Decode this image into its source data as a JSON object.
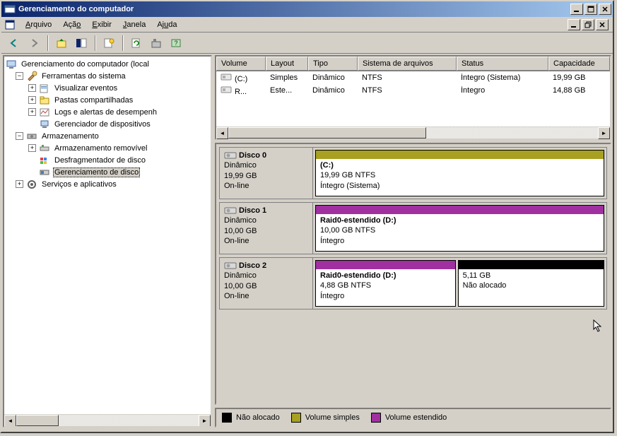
{
  "window": {
    "title": "Gerenciamento do computador"
  },
  "menu": {
    "arquivo": "Arquivo",
    "acao": "Ação",
    "exibir": "Exibir",
    "janela": "Janela",
    "ajuda": "Ajuda"
  },
  "tree": {
    "root": "Gerenciamento do computador (local",
    "ferramentas": "Ferramentas do sistema",
    "visualizar_eventos": "Visualizar eventos",
    "pastas_compartilhadas": "Pastas compartilhadas",
    "logs_alertas": "Logs e alertas de desempenh",
    "gerenciador_disp": "Gerenciador de dispositivos",
    "armazenamento": "Armazenamento",
    "armaz_removivel": "Armazenamento removível",
    "desfragmentador": "Desfragmentador de disco",
    "gerenciamento_disco": "Gerenciamento de disco",
    "servicos": "Serviços e aplicativos"
  },
  "volumes": {
    "headers": {
      "volume": "Volume",
      "layout": "Layout",
      "tipo": "Tipo",
      "sistema": "Sistema de arquivos",
      "status": "Status",
      "capacidade": "Capacidade"
    },
    "rows": [
      {
        "volume": "(C:)",
        "layout": "Simples",
        "tipo": "Dinâmico",
        "sistema": "NTFS",
        "status": "Íntegro (Sistema)",
        "capacidade": "19,99 GB"
      },
      {
        "volume": "R...",
        "layout": "Este...",
        "tipo": "Dinâmico",
        "sistema": "NTFS",
        "status": "Íntegro",
        "capacidade": "14,88 GB"
      }
    ]
  },
  "disks": [
    {
      "name": "Disco 0",
      "type": "Dinâmico",
      "size": "19,99 GB",
      "status": "On-line",
      "parts": [
        {
          "name": "(C:)",
          "info": "19,99 GB NTFS",
          "status": "Íntegro (Sistema)",
          "color": "#a8a020",
          "flex": 1
        }
      ]
    },
    {
      "name": "Disco 1",
      "type": "Dinâmico",
      "size": "10,00 GB",
      "status": "On-line",
      "parts": [
        {
          "name": "Raid0-estendido  (D:)",
          "info": "10,00 GB NTFS",
          "status": "Íntegro",
          "color": "#a030a0",
          "flex": 1
        }
      ]
    },
    {
      "name": "Disco 2",
      "type": "Dinâmico",
      "size": "10,00 GB",
      "status": "On-line",
      "parts": [
        {
          "name": "Raid0-estendido  (D:)",
          "info": "4,88 GB NTFS",
          "status": "Íntegro",
          "color": "#a030a0",
          "flex": 488
        },
        {
          "name": "",
          "info": "5,11 GB",
          "status": "Não alocado",
          "color": "#000000",
          "flex": 511
        }
      ]
    }
  ],
  "legend": {
    "nao_alocado": "Não alocado",
    "volume_simples": "Volume simples",
    "volume_estendido": "Volume estendido"
  },
  "colors": {
    "unallocated": "#000000",
    "simple": "#a8a020",
    "spanned": "#a030a0"
  }
}
